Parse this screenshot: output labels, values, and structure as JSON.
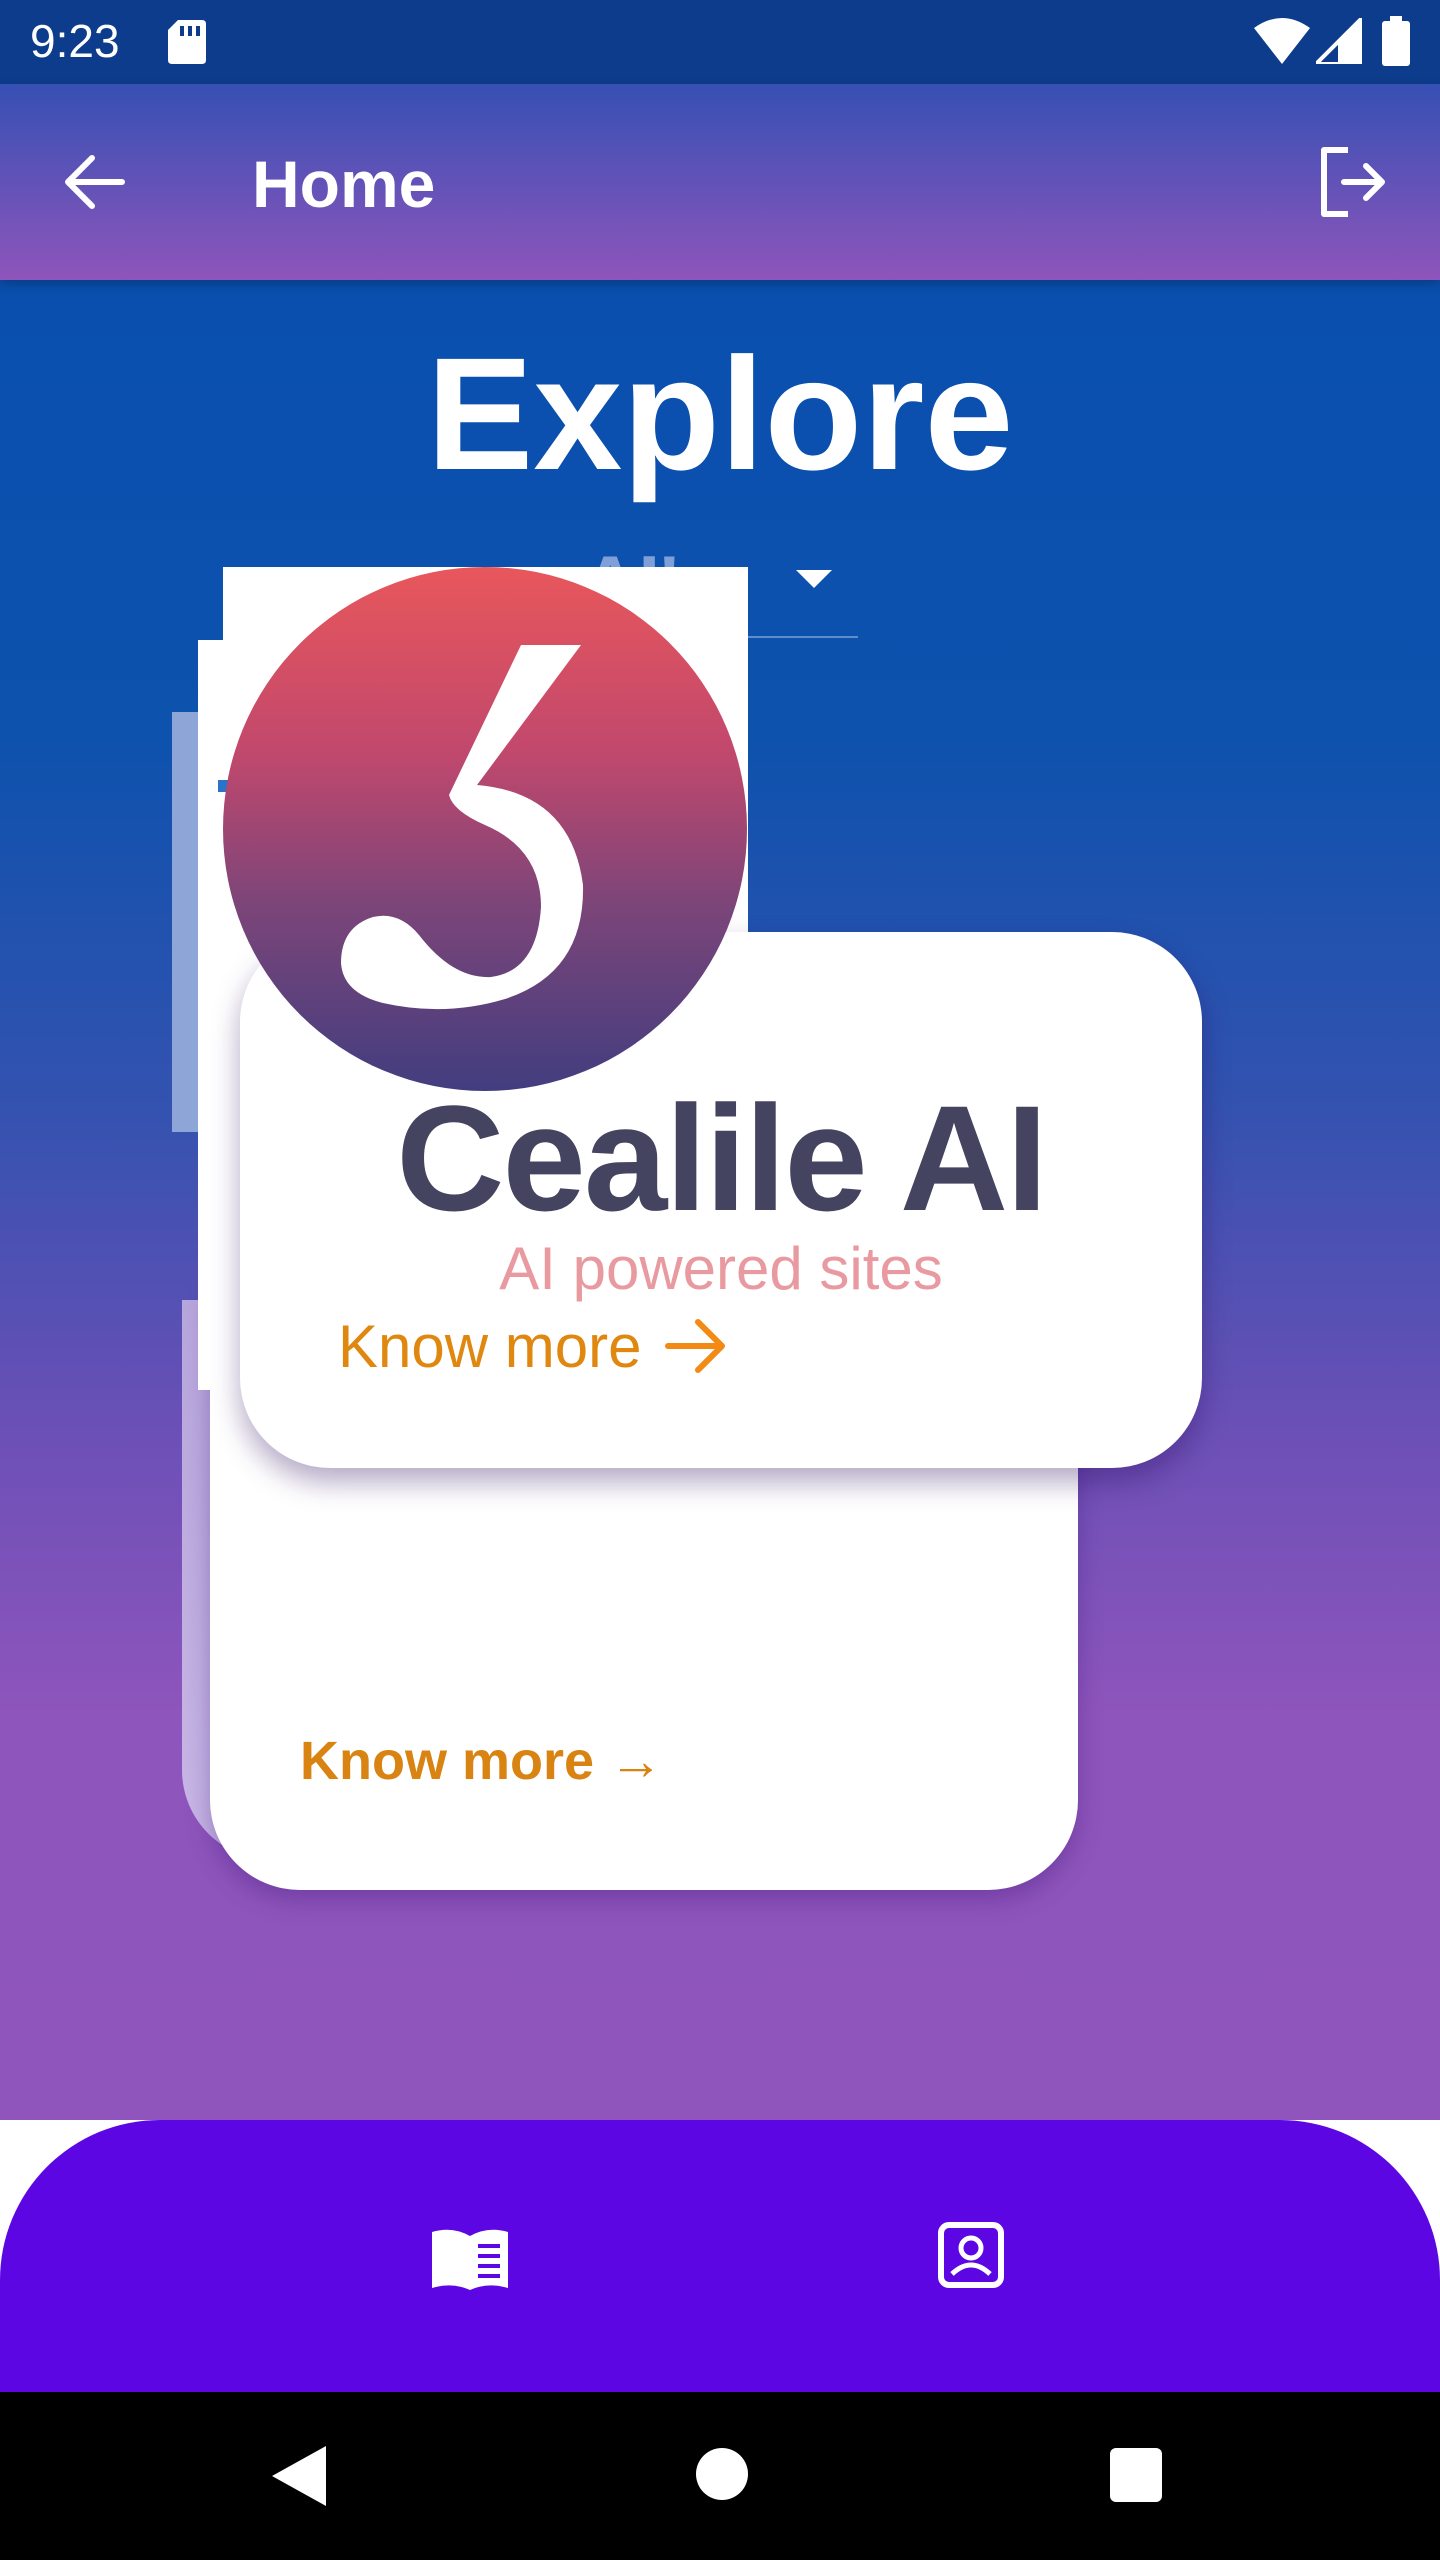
{
  "status_bar": {
    "time": "9:23",
    "icons": [
      "sd-card-icon",
      "wifi-icon",
      "signal-icon",
      "battery-icon"
    ]
  },
  "app_bar": {
    "title": "Home",
    "left_icon": "back-arrow-icon",
    "right_icon": "logout-icon",
    "gradient": [
      "#3650b4",
      "#8e55bb"
    ]
  },
  "main": {
    "heading": "Explore",
    "dropdown": {
      "selected": "AI's"
    }
  },
  "cards": {
    "front": {
      "title": "Cealile AI",
      "subtitle": "AI powered sites",
      "link": "Know more",
      "logo_icon": "stylized-3-logo-icon"
    },
    "behind": {
      "link": "Know more →"
    }
  },
  "bottom_nav": {
    "items": [
      {
        "name": "book-icon"
      },
      {
        "name": "profile-icon"
      }
    ],
    "color": "#5d06e4"
  },
  "system_nav": [
    "back",
    "home",
    "recents"
  ],
  "colors": {
    "link": "#df870f",
    "subtitle": "#e89aa0",
    "title": "#454460"
  }
}
